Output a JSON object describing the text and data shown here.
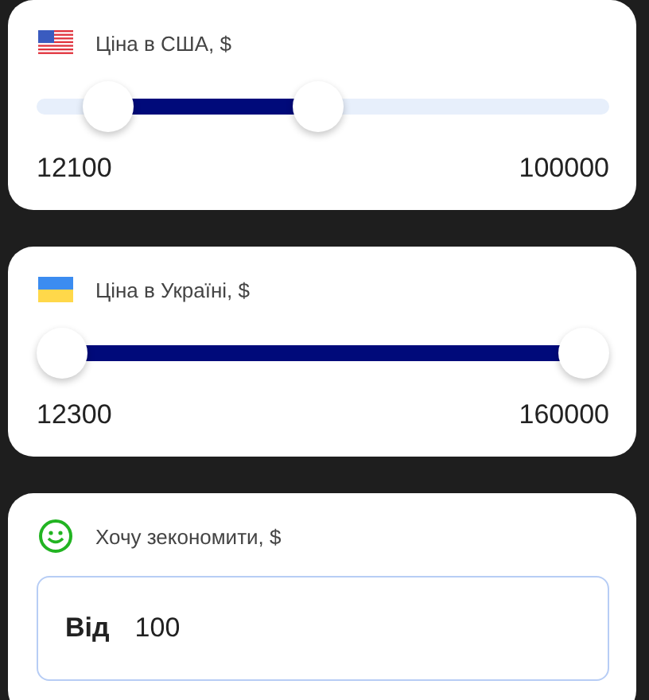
{
  "cards": [
    {
      "kind": "range",
      "title": "Ціна в США, $",
      "thumbs": [
        {
          "level": 0.088
        },
        {
          "level": 0.49
        }
      ],
      "min_label": "12100",
      "max_label": "100000"
    },
    {
      "kind": "range",
      "title": "Ціна в Україні, $",
      "thumbs": [
        {
          "level": 0
        },
        {
          "level": 1
        }
      ],
      "min_label": "12300",
      "max_label": "160000"
    },
    {
      "kind": "input",
      "title": "Хочу зекономити, $",
      "field_label": "Від",
      "value": "100"
    }
  ]
}
